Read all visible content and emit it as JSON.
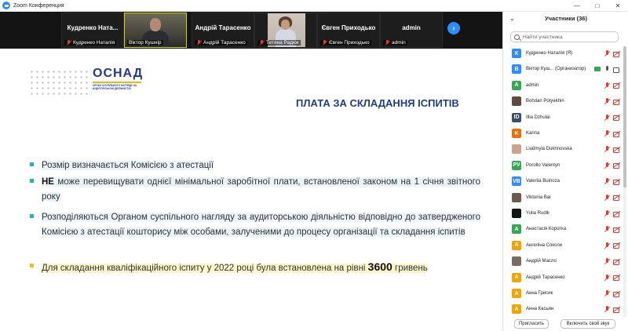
{
  "window": {
    "title": "Zoom Конференция"
  },
  "video_strip": {
    "tiles": [
      {
        "name": "Кудренко Ната...",
        "label": "Кудренко Наталія"
      },
      {
        "name": "",
        "label": "Віктор Кушнір",
        "active": true
      },
      {
        "name": "Андрій Тарасенко",
        "label": "Андрій Тарасенко"
      },
      {
        "name": "",
        "label": "Тетяна Радюк"
      },
      {
        "name": "Євген Приходько",
        "label": "Євген Приходько"
      },
      {
        "name": "admin",
        "label": "admin"
      }
    ]
  },
  "slide": {
    "logo": {
      "name": "ОСНАД",
      "subtitle": "ОРГАН СУСПІЛЬНОГО НАГЛЯДУ ЗА АУДИТОРСЬКОЮ ДІЯЛЬНІСТЮ"
    },
    "title": "ПЛАТА ЗА СКЛАДАННЯ ІСПИТІВ",
    "bullets": [
      {
        "text": "Розмір визначається Комісією з атестації"
      },
      {
        "bold": "НЕ",
        "text": " може перевищувати однієї мінімальної заробітної плати, встановленої законом на 1 січня звітного року"
      },
      {
        "text": "Розподіляються Органом суспільного нагляду за аудиторською діяльністю відповідно до затвердженого Комісією з атестації кошторису між особами, залученими до процесу організації та складання іспитів"
      },
      {
        "text": "Для складання кваліфікаційного іспиту у 2022 році була встановлена на рівні ",
        "big": "3600",
        "tail": " гривень"
      }
    ]
  },
  "panel": {
    "title": "Участники (36)",
    "search_placeholder": "Найти участника",
    "participants": [
      {
        "initial": "К",
        "color": "#2d8cff",
        "name": "Кудренко Наталія (Я)",
        "mic": "off",
        "cam": "off"
      },
      {
        "initial": "В",
        "color": "#2d8cff",
        "name": "Віктор Куш... (Организатор)",
        "mic": "on",
        "cam": "on",
        "screen": true
      },
      {
        "initial": "A",
        "color": "#34a853",
        "name": "admin",
        "mic": "off",
        "cam": "off"
      },
      {
        "initial": "",
        "color": "#5b4a3d",
        "name": "Bohdan Potyekhin",
        "mic": "off",
        "cam": "off"
      },
      {
        "initial": "ID",
        "color": "#3a4e6e",
        "name": "Illia Dzhulai",
        "mic": "off",
        "cam": "off"
      },
      {
        "initial": "K",
        "color": "#e8710a",
        "name": "Karina",
        "mic": "off",
        "cam": "off"
      },
      {
        "initial": "",
        "color": "#c9a48a",
        "name": "Liudmyla Dukhnovska",
        "mic": "off",
        "cam": "off"
      },
      {
        "initial": "PV",
        "color": "#34a853",
        "name": "Porollo Valentyn",
        "mic": "off",
        "cam": "off"
      },
      {
        "initial": "VB",
        "color": "#2d8cff",
        "name": "Valeriia Buinoza",
        "mic": "off",
        "cam": "off"
      },
      {
        "initial": "",
        "color": "#6d5a4e",
        "name": "Viktoriia Bai",
        "mic": "off",
        "cam": "off"
      },
      {
        "initial": "",
        "color": "#141414",
        "name": "Yulia Rudik",
        "mic": "off",
        "cam": "off"
      },
      {
        "initial": "А",
        "color": "#34a853",
        "name": "Анастасія Коротка",
        "mic": "off",
        "cam": "off"
      },
      {
        "initial": "А",
        "color": "#f4a300",
        "name": "Ангеліна Соколи",
        "mic": "off",
        "cam": "off"
      },
      {
        "initial": "",
        "color": "#7a6a5f",
        "name": "Андрій Масло",
        "mic": "off",
        "cam": "off"
      },
      {
        "initial": "А",
        "color": "#f4a300",
        "name": "Андрій Тарасенко",
        "mic": "off",
        "cam": "off"
      },
      {
        "initial": "А",
        "color": "#f4a300",
        "name": "Анна Грисик",
        "mic": "off",
        "cam": "off"
      },
      {
        "initial": "А",
        "color": "#f4a300",
        "name": "Анна Касьян",
        "mic": "off",
        "cam": "off"
      }
    ],
    "invite_label": "Пригласить",
    "unmute_label": "Включить свой звук"
  }
}
